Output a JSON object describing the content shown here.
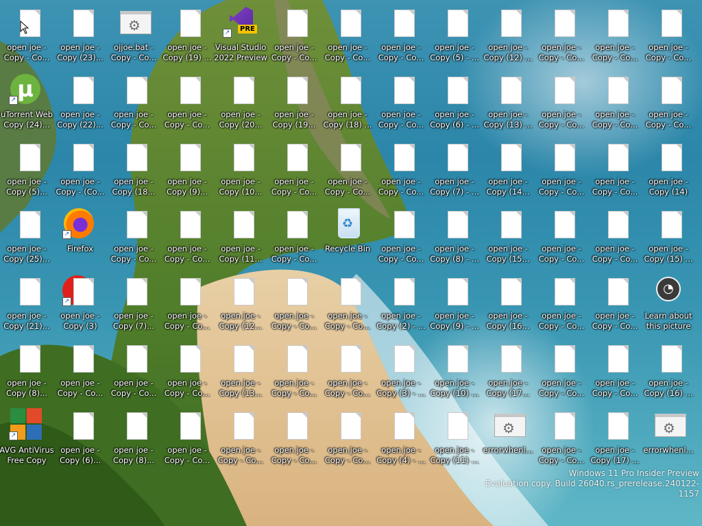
{
  "desktop": {
    "icons": [
      {
        "type": "file",
        "label": "open joe - Copy - Co..."
      },
      {
        "type": "file",
        "label": "open joe - Copy (23)..."
      },
      {
        "type": "bat",
        "label": "ojjoe.bat - Copy - Co..."
      },
      {
        "type": "file",
        "label": "open joe - Copy (19) ..."
      },
      {
        "type": "vs",
        "label": "Visual Studio 2022 Preview"
      },
      {
        "type": "file",
        "label": "open joe - Copy - Co..."
      },
      {
        "type": "file",
        "label": "open joe - Copy - Co..."
      },
      {
        "type": "file",
        "label": "open joe - Copy - Co..."
      },
      {
        "type": "file",
        "label": "open joe - Copy (5) - ..."
      },
      {
        "type": "file",
        "label": "open joe - Copy (12) ..."
      },
      {
        "type": "file",
        "label": "open joe - Copy - Co..."
      },
      {
        "type": "file",
        "label": "open joe - Copy - Co..."
      },
      {
        "type": "file",
        "label": "open joe - Copy - Co..."
      },
      {
        "type": "utorrent",
        "label": "uTorrent Web Copy (24)..."
      },
      {
        "type": "file",
        "label": "open joe - Copy (22)..."
      },
      {
        "type": "file",
        "label": "open joe - Copy - Co..."
      },
      {
        "type": "file",
        "label": "open joe - Copy - Co..."
      },
      {
        "type": "file",
        "label": "open joe - Copy (20..."
      },
      {
        "type": "file",
        "label": "open joe - Copy (19..."
      },
      {
        "type": "file",
        "label": "open joe - Copy (18) ..."
      },
      {
        "type": "file",
        "label": "open joe - Copy - Co..."
      },
      {
        "type": "file",
        "label": "open joe - Copy (6) - ..."
      },
      {
        "type": "file",
        "label": "open joe - Copy (13) ..."
      },
      {
        "type": "file",
        "label": "open joe - Copy - Co..."
      },
      {
        "type": "file",
        "label": "open joe - Copy - Co..."
      },
      {
        "type": "file",
        "label": "open joe - Copy - Co..."
      },
      {
        "type": "file",
        "label": "open joe - Copy (5)..."
      },
      {
        "type": "file",
        "label": "open joe - Copy - (Co..."
      },
      {
        "type": "file",
        "label": "open joe - Copy (18..."
      },
      {
        "type": "file",
        "label": "open joe - Copy (9)..."
      },
      {
        "type": "file",
        "label": "open joe - Copy (10..."
      },
      {
        "type": "file",
        "label": "open joe - Copy - Co..."
      },
      {
        "type": "file",
        "label": "open joe - Copy - Co..."
      },
      {
        "type": "file",
        "label": "open joe - Copy - Co..."
      },
      {
        "type": "file",
        "label": "open joe - Copy (7) - ..."
      },
      {
        "type": "file",
        "label": "open joe - Copy (14..."
      },
      {
        "type": "file",
        "label": "open joe - Copy - Co..."
      },
      {
        "type": "file",
        "label": "open joe - Copy - Co..."
      },
      {
        "type": "file",
        "label": "open joe - Copy (14)"
      },
      {
        "type": "file",
        "label": "open joe - Copy (25)..."
      },
      {
        "type": "firefox",
        "label": "Firefox"
      },
      {
        "type": "file",
        "label": "open joe - Copy - Co..."
      },
      {
        "type": "file",
        "label": "open joe - Copy - Co..."
      },
      {
        "type": "file",
        "label": "open joe - Copy (11..."
      },
      {
        "type": "file",
        "label": "open joe - Copy - Co..."
      },
      {
        "type": "recycle",
        "label": "Recycle Bin"
      },
      {
        "type": "file",
        "label": "open joe - Copy - Co..."
      },
      {
        "type": "file",
        "label": "open joe - Copy (8) - ..."
      },
      {
        "type": "file",
        "label": "open joe - Copy (15..."
      },
      {
        "type": "file",
        "label": "open joe - Copy - Co..."
      },
      {
        "type": "file",
        "label": "open joe - Copy - Co..."
      },
      {
        "type": "file",
        "label": "open joe - Copy (15) ..."
      },
      {
        "type": "file",
        "label": "open joe - Copy (21)..."
      },
      {
        "type": "redfile",
        "label": "open joe - Copy (3)"
      },
      {
        "type": "file",
        "label": "open joe - Copy (7)..."
      },
      {
        "type": "file",
        "label": "open joe - Copy - Co..."
      },
      {
        "type": "file",
        "label": "open joe - Copy (12..."
      },
      {
        "type": "file",
        "label": "open joe - Copy - Co..."
      },
      {
        "type": "file",
        "label": "open joe - Copy - Co..."
      },
      {
        "type": "file",
        "label": "open joe - Copy (2) - ..."
      },
      {
        "type": "file",
        "label": "open joe - Copy (9) - ..."
      },
      {
        "type": "file",
        "label": "open joe - Copy (16..."
      },
      {
        "type": "file",
        "label": "open joe - Copy - Co..."
      },
      {
        "type": "file",
        "label": "open joe - Copy - Co..."
      },
      {
        "type": "learn",
        "label": "Learn about this picture"
      },
      {
        "type": "file",
        "label": "open joe - Copy (8)..."
      },
      {
        "type": "file",
        "label": "open joe - Copy - Co..."
      },
      {
        "type": "file",
        "label": "open joe - Copy - Co..."
      },
      {
        "type": "file",
        "label": "open joe - Copy - Co..."
      },
      {
        "type": "file",
        "label": "open joe - Copy (13..."
      },
      {
        "type": "file",
        "label": "open joe - Copy - Co..."
      },
      {
        "type": "file",
        "label": "open joe - Copy - Co..."
      },
      {
        "type": "file",
        "label": "open joe - Copy (3) - ..."
      },
      {
        "type": "file",
        "label": "open joe - Copy (10) ..."
      },
      {
        "type": "file",
        "label": "open joe - Copy (17..."
      },
      {
        "type": "file",
        "label": "open joe - Copy - Co..."
      },
      {
        "type": "file",
        "label": "open joe - Copy - Co..."
      },
      {
        "type": "file",
        "label": "open joe - Copy (16) ..."
      },
      {
        "type": "avg",
        "label": "AVG AntiVirus Free Copy"
      },
      {
        "type": "file",
        "label": "open joe - Copy (6)..."
      },
      {
        "type": "file",
        "label": "open joe - Copy (8)..."
      },
      {
        "type": "file",
        "label": "open joe - Copy - Co..."
      },
      {
        "type": "file",
        "label": "open joe - Copy - Co..."
      },
      {
        "type": "file",
        "label": "open joe - Copy - Co..."
      },
      {
        "type": "file",
        "label": "open joe - Copy - Co..."
      },
      {
        "type": "file",
        "label": "open joe - Copy (4) - ..."
      },
      {
        "type": "file",
        "label": "open joe - Copy (11) ..."
      },
      {
        "type": "bat",
        "label": "errorwhenl..."
      },
      {
        "type": "file",
        "label": "open joe - Copy - Co..."
      },
      {
        "type": "file",
        "label": "open joe - Copy (17) ..."
      },
      {
        "type": "bat",
        "label": "errorwhenl..."
      }
    ]
  },
  "watermark": {
    "line1": "Windows 11 Pro Insider Preview",
    "line2": "Evaluation copy. Build 26040.rs_prerelease.240122-1157"
  },
  "colors": {
    "sea": "#2b86a9",
    "cliff": "#4f7d2a",
    "sand": "#e6c79a"
  }
}
